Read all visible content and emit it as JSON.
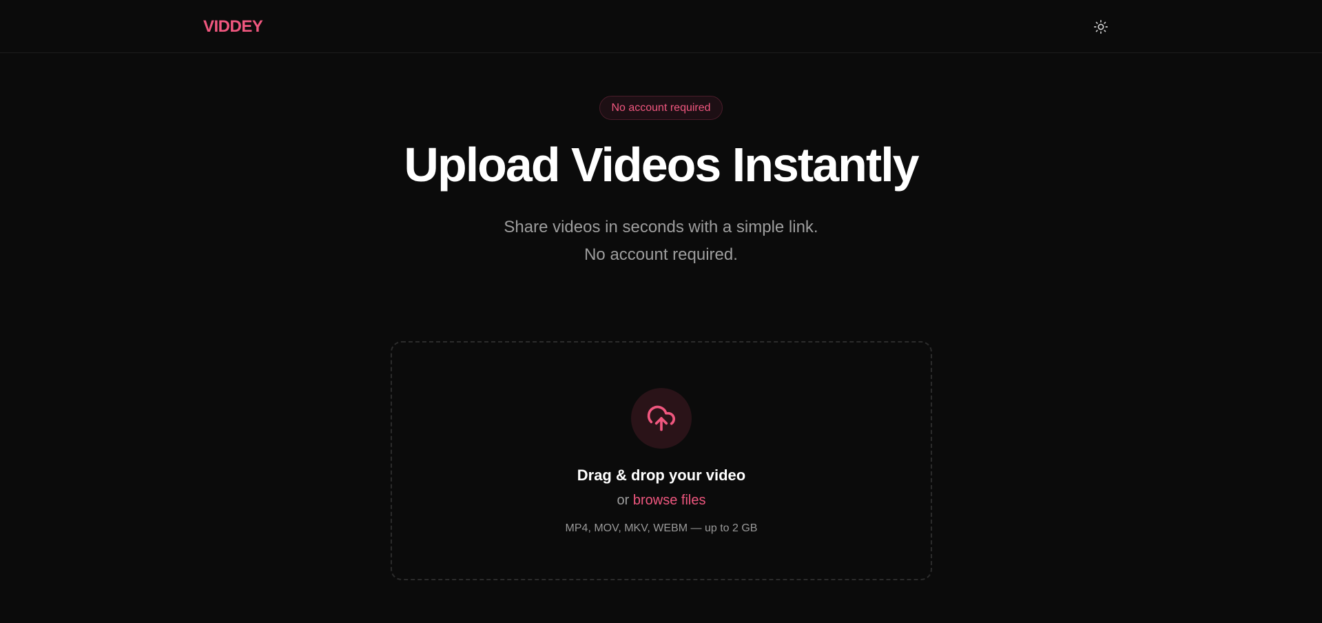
{
  "header": {
    "brand": "VIDDEY",
    "theme_icon": "sun-icon"
  },
  "hero": {
    "badge": "No account required",
    "title": "Upload Videos Instantly",
    "subtitle_line1": "Share videos in seconds with a simple link.",
    "subtitle_line2": "No account required."
  },
  "dropzone": {
    "icon": "cloud-upload-icon",
    "title": "Drag & drop your video",
    "or_text": "or",
    "browse_label": "browse files",
    "formats": "MP4, MOV, MKV, WEBM — up to 2 GB"
  },
  "colors": {
    "accent": "#f0577f",
    "background": "#0b0b0b",
    "muted_text": "#9e9e9e",
    "icon_circle": "#2a1318"
  }
}
